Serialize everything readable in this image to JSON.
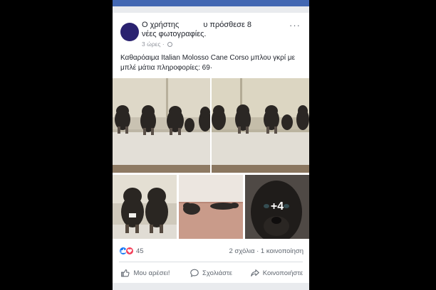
{
  "post": {
    "author_line1": "Ο χρήστης",
    "author_suffix": "υ πρόσθεσε 8",
    "author_line2": "νέες φωτογραφίες.",
    "timestamp": "3 ώρες",
    "separator": "·",
    "more_label": "···",
    "text": "Καθαρόαιμα Italian Molosso Cane Corso μπλου γκρί με μπλέ μάτια πληροφορίες: 69·",
    "more_photos": "+4"
  },
  "stats": {
    "reaction_count": "45",
    "comments_shares": "2 σχόλια · 1 κοινοποίηση"
  },
  "actions": {
    "like": "Μου αρέσει!",
    "comment": "Σχολιάστε",
    "share": "Κοινοποιήστε"
  },
  "icons": {
    "like": "thumbs-up-icon",
    "comment": "comment-bubble-icon",
    "share": "share-arrow-icon",
    "privacy": "globe-icon",
    "more": "ellipsis-icon"
  },
  "colors": {
    "brand_blue": "#4267b2",
    "like_blue": "#1877f2",
    "love_red": "#f33e58",
    "text_dark": "#1d2129",
    "text_grey": "#606770"
  }
}
